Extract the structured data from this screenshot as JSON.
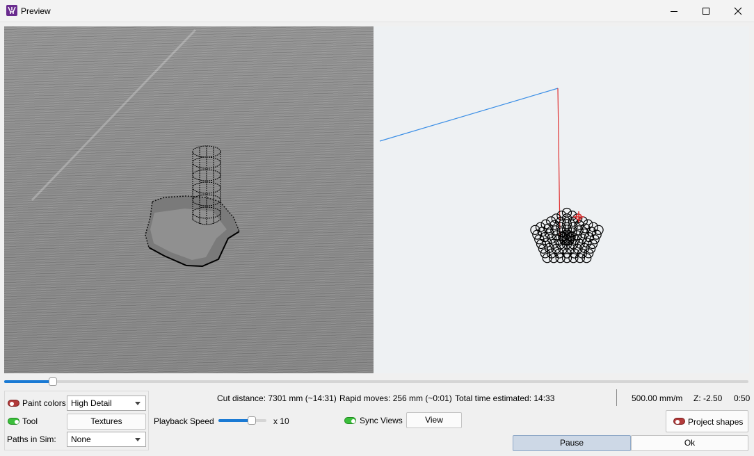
{
  "window": {
    "title": "Preview",
    "minimize_icon": "minimize-icon",
    "maximize_icon": "maximize-icon",
    "close_icon": "close-icon"
  },
  "simulation": {
    "progress_fraction": 0.065
  },
  "options": {
    "paint_colors": {
      "label": "Paint colors",
      "toggle_on": false,
      "value": "High Detail"
    },
    "tool": {
      "label": "Tool",
      "toggle_on": true,
      "button": "Textures"
    },
    "paths_in_sim": {
      "label": "Paths in Sim:",
      "value": "None"
    }
  },
  "stats": {
    "cut_distance": "Cut distance: 7301 mm (~14:31)",
    "rapid_moves": "Rapid moves: 256 mm (~0:01)",
    "total_time": "Total time estimated: 14:33",
    "feed_rate": "500.00 mm/m",
    "z": "Z: -2.50",
    "elapsed": "0:50"
  },
  "playback": {
    "label": "Playback Speed",
    "multiplier": "x 10",
    "speed_fraction": 0.7
  },
  "sync_views": {
    "label": "Sync Views",
    "toggle_on": true,
    "button": "View"
  },
  "project_shapes": {
    "label": "Project shapes",
    "toggle_on": false
  },
  "actions": {
    "pause": "Pause",
    "ok": "Ok"
  },
  "colors": {
    "accent": "#1a7ad4",
    "toggle_on": "#3bbf3b",
    "toggle_off": "#b23a3a",
    "path_rapid": "#3a8ee6",
    "path_plunge": "#e03030"
  }
}
